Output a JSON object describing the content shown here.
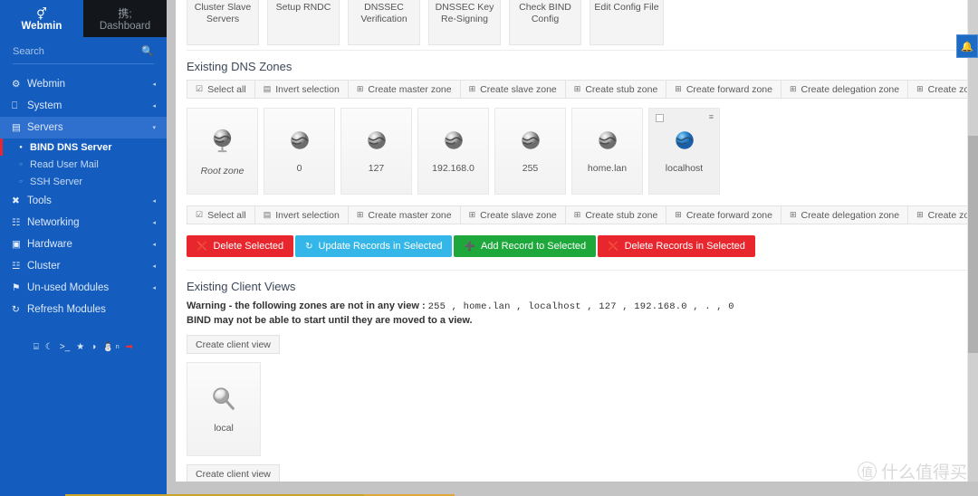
{
  "sidebar": {
    "brand": {
      "label": "Webmin",
      "icon": "webmin-logo-icon"
    },
    "dashboard": {
      "label": "Dashboard",
      "icon": "gauge-icon"
    },
    "search": {
      "placeholder": "Search",
      "icon": "search-icon"
    },
    "items": [
      {
        "label": "Webmin",
        "icon": "gear-icon",
        "arrow": "◂",
        "state": "collapsed"
      },
      {
        "label": "System",
        "icon": "⌸",
        "arrow": "◂",
        "state": "collapsed"
      },
      {
        "label": "Servers",
        "icon": "☰",
        "arrow": "▾",
        "state": "expanded"
      },
      {
        "label": "Tools",
        "icon": "✖",
        "arrow": "◂",
        "state": "collapsed"
      },
      {
        "label": "Networking",
        "icon": "⛓",
        "arrow": "◂",
        "state": "collapsed"
      },
      {
        "label": "Hardware",
        "icon": "▣",
        "arrow": "◂",
        "state": "collapsed"
      },
      {
        "label": "Cluster",
        "icon": "≣",
        "arrow": "◂",
        "state": "collapsed"
      },
      {
        "label": "Un-used Modules",
        "icon": "⚑",
        "arrow": "◂",
        "state": "collapsed"
      },
      {
        "label": "Refresh Modules",
        "icon": "↻",
        "arrow": "",
        "state": "none"
      }
    ],
    "servers_children": [
      {
        "label": "BIND DNS Server",
        "current": true
      },
      {
        "label": "Read User Mail",
        "current": false
      },
      {
        "label": "SSH Server",
        "current": false
      }
    ],
    "footer_icons": [
      {
        "name": "collapse-sidebar-icon",
        "glyph": "⌶"
      },
      {
        "name": "dark-mode-icon",
        "glyph": "☾"
      },
      {
        "name": "terminal-icon",
        "glyph": "⌫"
      },
      {
        "name": "favorites-icon",
        "glyph": "★"
      },
      {
        "name": "theme-palette-icon",
        "glyph": "◕"
      },
      {
        "name": "user-icon",
        "glyph": "⛬"
      },
      {
        "name": "user-label",
        "glyph": "n"
      },
      {
        "name": "logout-icon",
        "glyph": "⮕"
      }
    ]
  },
  "topcards": [
    {
      "label": "Cluster Slave Servers"
    },
    {
      "label": "Setup RNDC"
    },
    {
      "label": "DNSSEC Verification"
    },
    {
      "label": "DNSSEC Key Re-Signing"
    },
    {
      "label": "Check BIND Config"
    },
    {
      "label": "Edit Config File"
    }
  ],
  "zones_section": {
    "title": "Existing DNS Zones",
    "toolbar": [
      {
        "label": "Select all",
        "icon": "checkbox-checked-icon"
      },
      {
        "label": "Invert selection",
        "icon": "invert-selection-icon"
      },
      {
        "label": "Create master zone",
        "icon": "add-box-icon"
      },
      {
        "label": "Create slave zone",
        "icon": "add-box-icon"
      },
      {
        "label": "Create stub zone",
        "icon": "add-box-icon"
      },
      {
        "label": "Create forward zone",
        "icon": "add-box-icon"
      },
      {
        "label": "Create delegation zone",
        "icon": "add-box-icon"
      },
      {
        "label": "Create zones from batch file",
        "icon": "add-box-icon"
      }
    ],
    "zones": [
      {
        "label": "Root zone",
        "italic": true,
        "icon": "globe-icon",
        "selected": false,
        "big": true
      },
      {
        "label": "0",
        "italic": false,
        "icon": "globe-icon",
        "selected": false,
        "big": false
      },
      {
        "label": "127",
        "italic": false,
        "icon": "globe-icon",
        "selected": false,
        "big": false
      },
      {
        "label": "192.168.0",
        "italic": false,
        "icon": "globe-icon",
        "selected": false,
        "big": false
      },
      {
        "label": "255",
        "italic": false,
        "icon": "globe-icon",
        "selected": false,
        "big": false
      },
      {
        "label": "home.lan",
        "italic": false,
        "icon": "globe-icon",
        "selected": false,
        "big": false
      },
      {
        "label": "localhost",
        "italic": false,
        "icon": "globe-blue-icon",
        "selected": true,
        "big": false
      }
    ],
    "actions": [
      {
        "label": "Delete Selected",
        "color": "red",
        "icon": "delete-icon"
      },
      {
        "label": "Update Records in Selected",
        "color": "blue",
        "icon": "refresh-icon"
      },
      {
        "label": "Add Record to Selected",
        "color": "green",
        "icon": "plus-icon"
      },
      {
        "label": "Delete Records in Selected",
        "color": "red",
        "icon": "delete-icon"
      }
    ]
  },
  "views_section": {
    "title": "Existing Client Views",
    "warning_prefix": "Warning - the following zones are not in any view : ",
    "warning_zones": "255 , home.lan , localhost , 127 , 192.168.0 , . , 0",
    "warning_line2": "BIND may not be able to start until they are moved to a view.",
    "create_button_top": "Create client view",
    "create_button_bottom": "Create client view",
    "views": [
      {
        "label": "local",
        "icon": "magnifier-icon"
      }
    ]
  },
  "notification": {
    "icon": "bell-icon"
  },
  "watermark": {
    "mark": "值",
    "text": "什么值得买"
  },
  "colors": {
    "sidebar": "#145dbf",
    "dashboard": "#13171c",
    "danger": "#e8262d",
    "info": "#35b6e8",
    "success": "#1ea83c",
    "accent": "#1e6bc4"
  }
}
